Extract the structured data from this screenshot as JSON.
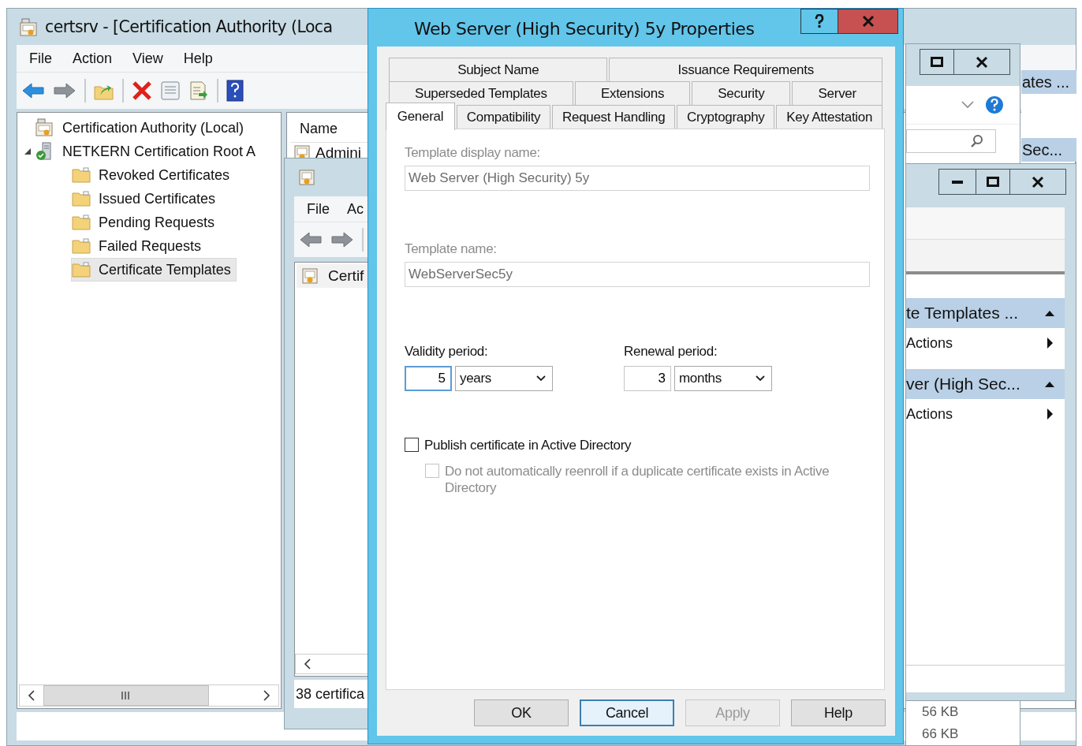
{
  "main_window": {
    "title": "certsrv - [Certification Authority (Loca",
    "menu": [
      "File",
      "Action",
      "View",
      "Help"
    ],
    "tree": [
      {
        "label": "Certification Authority (Local)",
        "kind": "ca",
        "selected": false,
        "children": [
          {
            "label": "NETKERN Certification Root A",
            "kind": "server",
            "selected": false,
            "expanded": true,
            "children": [
              {
                "label": "Revoked Certificates",
                "kind": "folder",
                "selected": false
              },
              {
                "label": "Issued Certificates",
                "kind": "folder",
                "selected": false
              },
              {
                "label": "Pending Requests",
                "kind": "folder",
                "selected": false
              },
              {
                "label": "Failed Requests",
                "kind": "folder",
                "selected": false
              },
              {
                "label": "Certificate Templates",
                "kind": "folder",
                "selected": true
              }
            ]
          }
        ]
      }
    ],
    "list_column": "Name",
    "list_rows": [
      "Admini"
    ],
    "action_headers": [
      "ates ...",
      "Sec..."
    ]
  },
  "snapin_window": {
    "menu": [
      "File",
      "Ac"
    ],
    "list_rows": [
      "Certif"
    ],
    "status": "38 certifica"
  },
  "explorer_window": {
    "sizes": [
      "56 KB",
      "66 KB"
    ]
  },
  "actions_window": {
    "sections": [
      {
        "title": "te Templates ...",
        "expanded": true,
        "items": [
          "Actions"
        ]
      },
      {
        "title": "ver (High Sec...",
        "expanded": true,
        "items": [
          "Actions"
        ]
      }
    ]
  },
  "dialog": {
    "title": "Web Server (High Security) 5y Properties",
    "tab_rows": [
      [
        {
          "label": "Subject Name",
          "selected": false
        },
        {
          "label": "Issuance Requirements",
          "selected": false
        }
      ],
      [
        {
          "label": "Superseded Templates",
          "selected": false
        },
        {
          "label": "Extensions",
          "selected": false
        },
        {
          "label": "Security",
          "selected": false
        },
        {
          "label": "Server",
          "selected": false
        }
      ],
      [
        {
          "label": "General",
          "selected": true
        },
        {
          "label": "Compatibility",
          "selected": false
        },
        {
          "label": "Request Handling",
          "selected": false
        },
        {
          "label": "Cryptography",
          "selected": false
        },
        {
          "label": "Key Attestation",
          "selected": false
        }
      ]
    ],
    "fields": [
      {
        "label": "Template display name:",
        "value": "Web Server (High Security) 5y",
        "disabled": true
      },
      {
        "label": "Template name:",
        "value": "WebServerSec5y",
        "disabled": true
      }
    ],
    "periods": [
      {
        "label": "Validity period:",
        "value": "5",
        "unit": "years",
        "focused": true
      },
      {
        "label": "Renewal period:",
        "value": "3",
        "unit": "months",
        "focused": false
      }
    ],
    "checkboxes": [
      {
        "label": "Publish certificate in Active Directory",
        "checked": false,
        "disabled": false,
        "children": [
          {
            "label": "Do not automatically reenroll if a duplicate certificate exists in Active Directory",
            "checked": false,
            "disabled": true
          }
        ]
      }
    ],
    "buttons": [
      {
        "label": "OK",
        "focused": false,
        "disabled": false
      },
      {
        "label": "Cancel",
        "focused": true,
        "disabled": false
      },
      {
        "label": "Apply",
        "focused": false,
        "disabled": true
      },
      {
        "label": "Help",
        "focused": false,
        "disabled": false
      }
    ]
  }
}
